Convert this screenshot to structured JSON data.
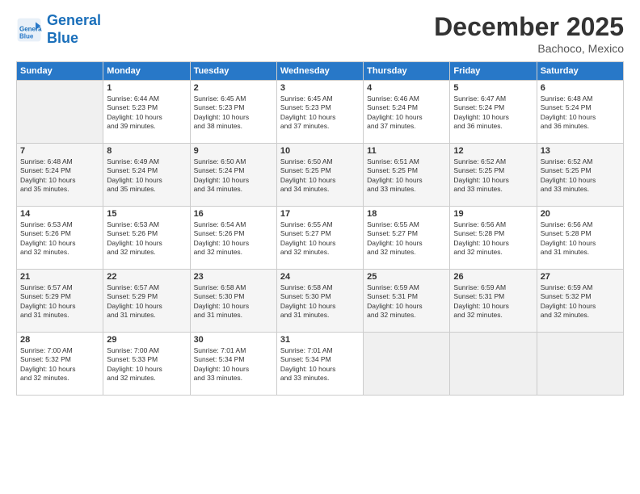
{
  "header": {
    "logo_line1": "General",
    "logo_line2": "Blue",
    "month_year": "December 2025",
    "location": "Bachoco, Mexico"
  },
  "weekdays": [
    "Sunday",
    "Monday",
    "Tuesday",
    "Wednesday",
    "Thursday",
    "Friday",
    "Saturday"
  ],
  "weeks": [
    [
      {
        "day": "",
        "empty": true
      },
      {
        "day": "1",
        "sunrise": "6:44 AM",
        "sunset": "5:23 PM",
        "daylight": "10 hours and 39 minutes."
      },
      {
        "day": "2",
        "sunrise": "6:45 AM",
        "sunset": "5:23 PM",
        "daylight": "10 hours and 38 minutes."
      },
      {
        "day": "3",
        "sunrise": "6:45 AM",
        "sunset": "5:23 PM",
        "daylight": "10 hours and 37 minutes."
      },
      {
        "day": "4",
        "sunrise": "6:46 AM",
        "sunset": "5:24 PM",
        "daylight": "10 hours and 37 minutes."
      },
      {
        "day": "5",
        "sunrise": "6:47 AM",
        "sunset": "5:24 PM",
        "daylight": "10 hours and 36 minutes."
      },
      {
        "day": "6",
        "sunrise": "6:48 AM",
        "sunset": "5:24 PM",
        "daylight": "10 hours and 36 minutes."
      }
    ],
    [
      {
        "day": "7",
        "sunrise": "6:48 AM",
        "sunset": "5:24 PM",
        "daylight": "10 hours and 35 minutes."
      },
      {
        "day": "8",
        "sunrise": "6:49 AM",
        "sunset": "5:24 PM",
        "daylight": "10 hours and 35 minutes."
      },
      {
        "day": "9",
        "sunrise": "6:50 AM",
        "sunset": "5:24 PM",
        "daylight": "10 hours and 34 minutes."
      },
      {
        "day": "10",
        "sunrise": "6:50 AM",
        "sunset": "5:25 PM",
        "daylight": "10 hours and 34 minutes."
      },
      {
        "day": "11",
        "sunrise": "6:51 AM",
        "sunset": "5:25 PM",
        "daylight": "10 hours and 33 minutes."
      },
      {
        "day": "12",
        "sunrise": "6:52 AM",
        "sunset": "5:25 PM",
        "daylight": "10 hours and 33 minutes."
      },
      {
        "day": "13",
        "sunrise": "6:52 AM",
        "sunset": "5:25 PM",
        "daylight": "10 hours and 33 minutes."
      }
    ],
    [
      {
        "day": "14",
        "sunrise": "6:53 AM",
        "sunset": "5:26 PM",
        "daylight": "10 hours and 32 minutes."
      },
      {
        "day": "15",
        "sunrise": "6:53 AM",
        "sunset": "5:26 PM",
        "daylight": "10 hours and 32 minutes."
      },
      {
        "day": "16",
        "sunrise": "6:54 AM",
        "sunset": "5:26 PM",
        "daylight": "10 hours and 32 minutes."
      },
      {
        "day": "17",
        "sunrise": "6:55 AM",
        "sunset": "5:27 PM",
        "daylight": "10 hours and 32 minutes."
      },
      {
        "day": "18",
        "sunrise": "6:55 AM",
        "sunset": "5:27 PM",
        "daylight": "10 hours and 32 minutes."
      },
      {
        "day": "19",
        "sunrise": "6:56 AM",
        "sunset": "5:28 PM",
        "daylight": "10 hours and 32 minutes."
      },
      {
        "day": "20",
        "sunrise": "6:56 AM",
        "sunset": "5:28 PM",
        "daylight": "10 hours and 31 minutes."
      }
    ],
    [
      {
        "day": "21",
        "sunrise": "6:57 AM",
        "sunset": "5:29 PM",
        "daylight": "10 hours and 31 minutes."
      },
      {
        "day": "22",
        "sunrise": "6:57 AM",
        "sunset": "5:29 PM",
        "daylight": "10 hours and 31 minutes."
      },
      {
        "day": "23",
        "sunrise": "6:58 AM",
        "sunset": "5:30 PM",
        "daylight": "10 hours and 31 minutes."
      },
      {
        "day": "24",
        "sunrise": "6:58 AM",
        "sunset": "5:30 PM",
        "daylight": "10 hours and 31 minutes."
      },
      {
        "day": "25",
        "sunrise": "6:59 AM",
        "sunset": "5:31 PM",
        "daylight": "10 hours and 32 minutes."
      },
      {
        "day": "26",
        "sunrise": "6:59 AM",
        "sunset": "5:31 PM",
        "daylight": "10 hours and 32 minutes."
      },
      {
        "day": "27",
        "sunrise": "6:59 AM",
        "sunset": "5:32 PM",
        "daylight": "10 hours and 32 minutes."
      }
    ],
    [
      {
        "day": "28",
        "sunrise": "7:00 AM",
        "sunset": "5:32 PM",
        "daylight": "10 hours and 32 minutes."
      },
      {
        "day": "29",
        "sunrise": "7:00 AM",
        "sunset": "5:33 PM",
        "daylight": "10 hours and 32 minutes."
      },
      {
        "day": "30",
        "sunrise": "7:01 AM",
        "sunset": "5:34 PM",
        "daylight": "10 hours and 33 minutes."
      },
      {
        "day": "31",
        "sunrise": "7:01 AM",
        "sunset": "5:34 PM",
        "daylight": "10 hours and 33 minutes."
      },
      {
        "day": "",
        "empty": true
      },
      {
        "day": "",
        "empty": true
      },
      {
        "day": "",
        "empty": true
      }
    ]
  ]
}
